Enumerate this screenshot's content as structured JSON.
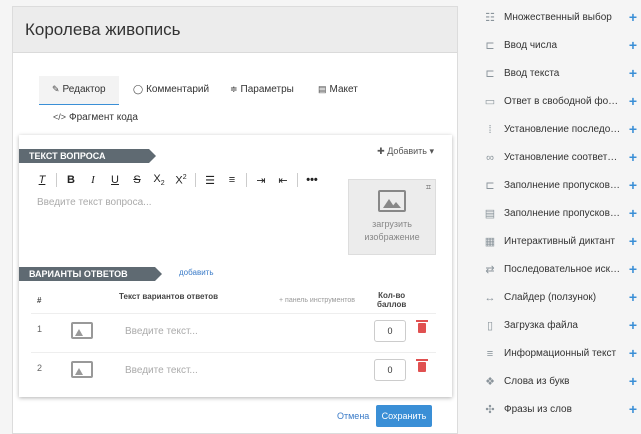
{
  "page_title": "Королева живопись",
  "tabs": [
    {
      "label": "Редактор",
      "icon": "edit-icon"
    },
    {
      "label": "Комментарий",
      "icon": "comment-icon"
    },
    {
      "label": "Параметры",
      "icon": "sliders-icon"
    },
    {
      "label": "Макет",
      "icon": "layout-icon"
    },
    {
      "label": "Фрагмент кода",
      "icon": "code-icon"
    }
  ],
  "question": {
    "section_label": "ТЕКСТ ВОПРОСА",
    "add_label": "Добавить",
    "placeholder": "Введите текст вопроса...",
    "upload_line1": "загрузить",
    "upload_line2": "изображение",
    "toolbar": [
      "clear-format",
      "bold",
      "italic",
      "underline",
      "strikethrough",
      "subscript",
      "superscript",
      "ordered-list",
      "bullet-list",
      "indent",
      "outdent",
      "more"
    ]
  },
  "answers": {
    "section_label": "ВАРИАНТЫ ОТВЕТОВ",
    "add_link": "добавить",
    "col_num": "#",
    "col_text": "Текст вариантов ответов",
    "col_toolbar": "+ панель инструментов",
    "col_score_1": "Кол-во",
    "col_score_2": "баллов",
    "rows": [
      {
        "num": "1",
        "placeholder": "Введите текст...",
        "score": "0"
      },
      {
        "num": "2",
        "placeholder": "Введите текст...",
        "score": "0"
      }
    ]
  },
  "footer": {
    "cancel": "Отмена",
    "save": "Сохранить"
  },
  "sidebar": {
    "items": [
      {
        "label": "Множественный выбор",
        "icon": "list-icon"
      },
      {
        "label": "Ввод числа",
        "icon": "input-icon"
      },
      {
        "label": "Ввод текста",
        "icon": "input-icon"
      },
      {
        "label": "Ответ в свободной форме",
        "icon": "freeform-icon"
      },
      {
        "label": "Установление последоват...",
        "icon": "order-icon"
      },
      {
        "label": "Установление соответствий",
        "icon": "link-icon"
      },
      {
        "label": "Заполнение пропусков (по...",
        "icon": "input-icon"
      },
      {
        "label": "Заполнение пропусков (сп...",
        "icon": "dropdown-icon"
      },
      {
        "label": "Интерактивный диктант",
        "icon": "grid-icon"
      },
      {
        "label": "Последовательное исключ...",
        "icon": "cycle-icon"
      },
      {
        "label": "Слайдер (ползунок)",
        "icon": "slider-icon"
      },
      {
        "label": "Загрузка файла",
        "icon": "file-icon"
      },
      {
        "label": "Информационный текст",
        "icon": "text-icon"
      },
      {
        "label": "Слова из букв",
        "icon": "blocks-icon"
      },
      {
        "label": "Фразы из слов",
        "icon": "puzzle-icon"
      }
    ],
    "add_symbol": "+"
  }
}
